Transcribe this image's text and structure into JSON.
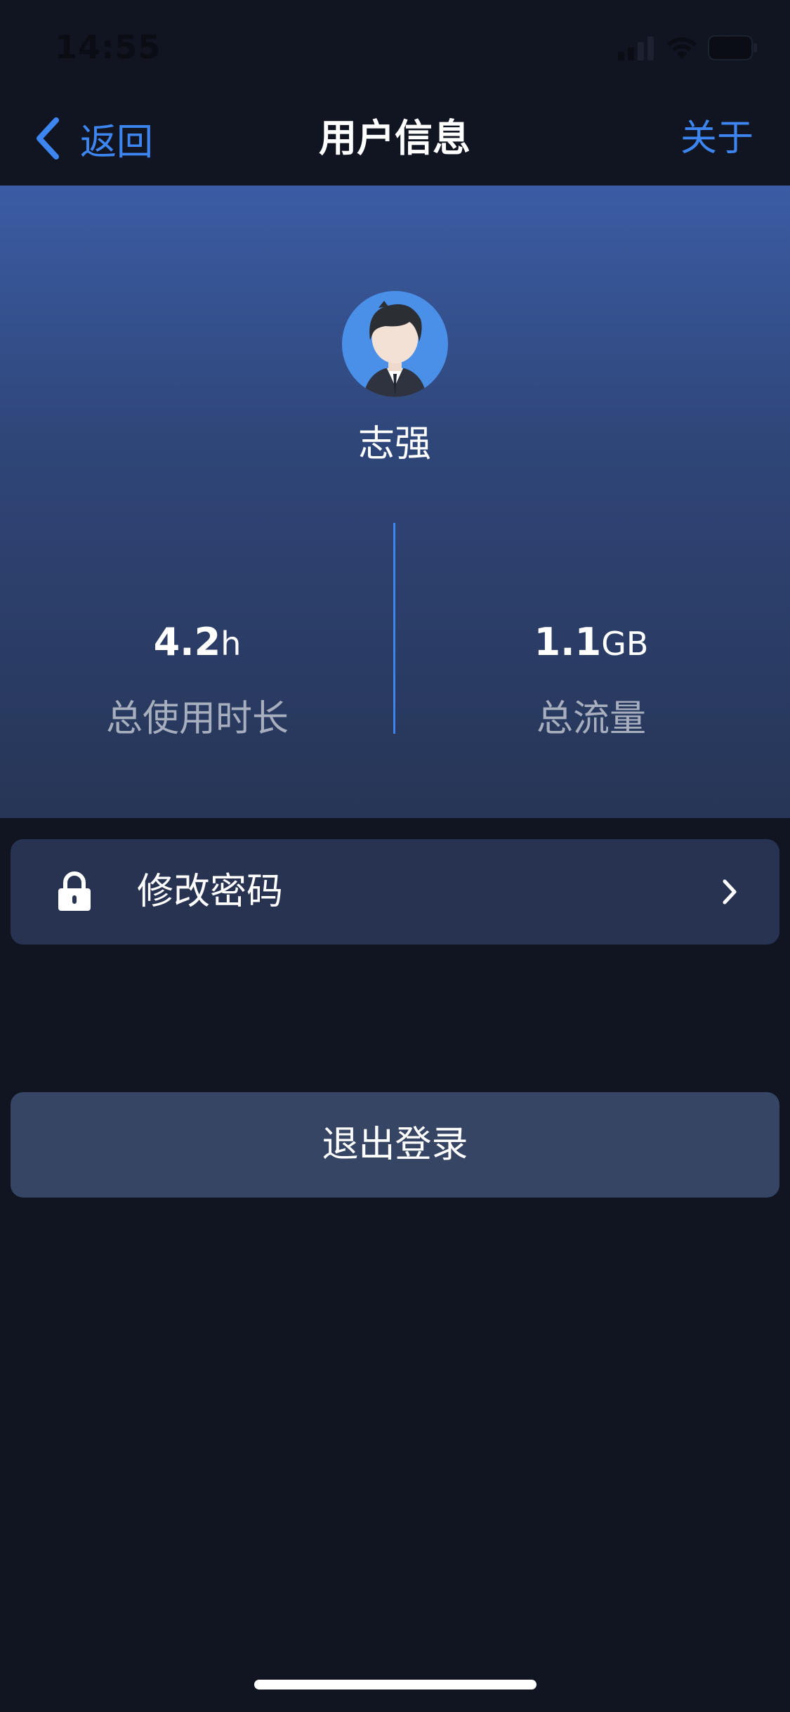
{
  "status_bar": {
    "time": "14:55",
    "battery": "65",
    "icons": [
      "signal-icon",
      "wifi-icon",
      "battery-icon"
    ]
  },
  "nav": {
    "back_label": "返回",
    "title": "用户信息",
    "about_label": "关于"
  },
  "profile": {
    "name": "志强",
    "avatar_icon": "user-avatar-icon"
  },
  "stats": {
    "usage": {
      "value": "4.2",
      "unit": "h",
      "label": "总使用时长"
    },
    "traffic": {
      "value": "1.1",
      "unit": "GB",
      "label": "总流量"
    }
  },
  "menu": {
    "change_password_label": "修改密码",
    "icons": [
      "lock-icon",
      "chevron-right-icon"
    ]
  },
  "actions": {
    "logout_label": "退出登录"
  },
  "colors": {
    "background": "#101521",
    "accent": "#3d85f0",
    "header_top": "#3b5ca4",
    "header_bottom": "#273556",
    "card": "#283352",
    "logout_button": "#354563",
    "avatar_bg": "#4a90e8"
  }
}
